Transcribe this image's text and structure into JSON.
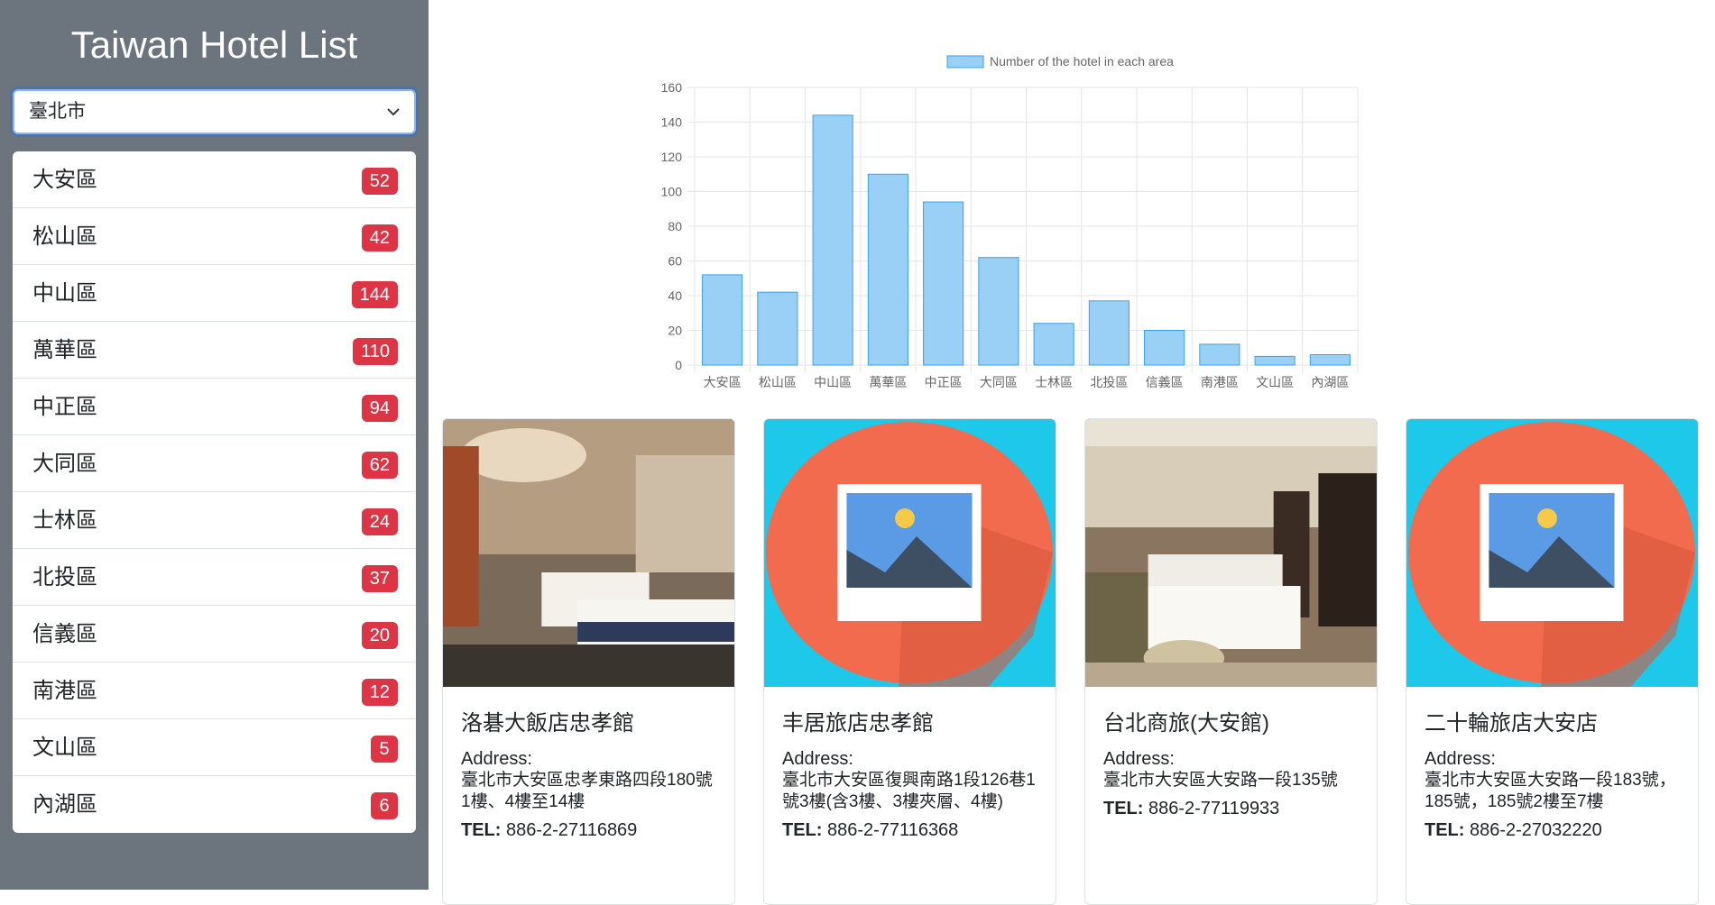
{
  "sidebar": {
    "title": "Taiwan Hotel List",
    "city_select": "臺北市",
    "districts": [
      {
        "name": "大安區",
        "count": "52"
      },
      {
        "name": "松山區",
        "count": "42"
      },
      {
        "name": "中山區",
        "count": "144"
      },
      {
        "name": "萬華區",
        "count": "110"
      },
      {
        "name": "中正區",
        "count": "94"
      },
      {
        "name": "大同區",
        "count": "62"
      },
      {
        "name": "士林區",
        "count": "24"
      },
      {
        "name": "北投區",
        "count": "37"
      },
      {
        "name": "信義區",
        "count": "20"
      },
      {
        "name": "南港區",
        "count": "12"
      },
      {
        "name": "文山區",
        "count": "5"
      },
      {
        "name": "內湖區",
        "count": "6"
      }
    ]
  },
  "chart_data": {
    "type": "bar",
    "legend": "Number of the hotel in each area",
    "categories": [
      "大安區",
      "松山區",
      "中山區",
      "萬華區",
      "中正區",
      "大同區",
      "士林區",
      "北投區",
      "信義區",
      "南港區",
      "文山區",
      "內湖區"
    ],
    "values": [
      52,
      42,
      144,
      110,
      94,
      62,
      24,
      37,
      20,
      12,
      5,
      6
    ],
    "ylim": [
      0,
      160
    ],
    "yticks": [
      0,
      20,
      40,
      60,
      80,
      100,
      120,
      140,
      160
    ],
    "bar_fill": "#9ad0f5",
    "bar_stroke": "#36a2eb",
    "grid": true,
    "legend_position": "top"
  },
  "cards": [
    {
      "name": "洛碁大飯店忠孝館",
      "address_label": "Address:",
      "address": "臺北市大安區忠孝東路四段180號1樓、4樓至14樓",
      "tel_label": "TEL:",
      "tel": " 886-2-27116869",
      "photo": "hotel-room"
    },
    {
      "name": "丰居旅店忠孝館",
      "address_label": "Address:",
      "address": "臺北市大安區復興南路1段126巷1號3樓(含3樓、3樓夾層、4樓)",
      "tel_label": "TEL:",
      "tel": " 886-2-77116368",
      "photo": "placeholder"
    },
    {
      "name": "台北商旅(大安館)",
      "address_label": "Address:",
      "address": "臺北市大安區大安路一段135號",
      "tel_label": "TEL:",
      "tel": " 886-2-77119933",
      "photo": "hotel-room"
    },
    {
      "name": "二十輪旅店大安店",
      "address_label": "Address:",
      "address": "臺北市大安區大安路一段183號，185號，185號2樓至7樓",
      "tel_label": "TEL:",
      "tel": " 886-2-27032220",
      "photo": "placeholder"
    }
  ],
  "colors": {
    "sidebar_bg": "#6c757d",
    "badge": "#dc3545",
    "placeholder_bg": "#1ec8e8",
    "placeholder_circle": "#f26b4f"
  }
}
